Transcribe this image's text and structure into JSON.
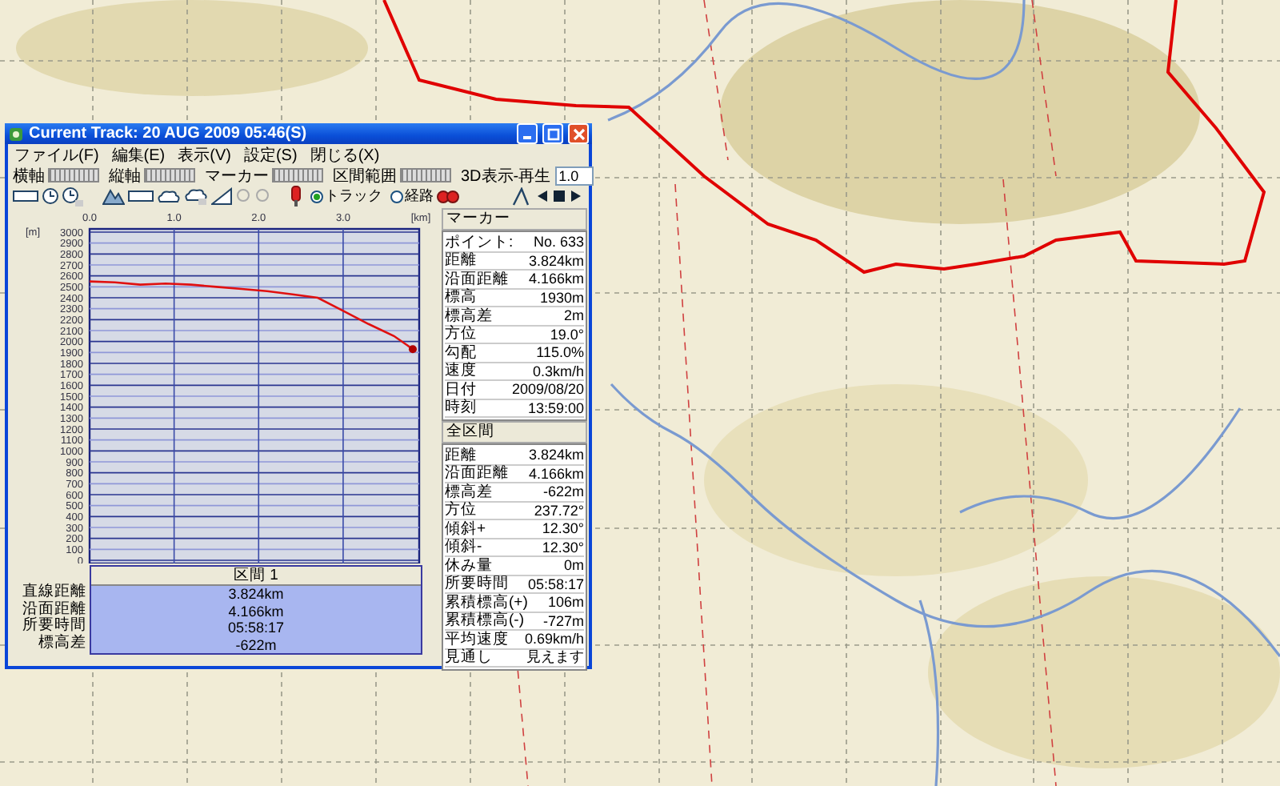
{
  "window": {
    "title": "Current Track: 20 AUG 2009 05:46(S)"
  },
  "menu": [
    "ファイル(F)",
    "編集(E)",
    "表示(V)",
    "設定(S)",
    "閉じる(X)"
  ],
  "toolbar": {
    "sliders": [
      {
        "label": "横軸"
      },
      {
        "label": "縦軸"
      },
      {
        "label": "マーカー"
      },
      {
        "label": "区間範囲"
      }
    ],
    "playback": {
      "label": "3D表示-再生",
      "value": "1.0"
    },
    "radios": [
      {
        "label": "トラック",
        "selected": true
      },
      {
        "label": "経路",
        "selected": false
      }
    ]
  },
  "profile": {
    "chart_data": {
      "type": "line",
      "xlabel": "[km]",
      "ylabel": "[m]",
      "xlim": [
        0,
        3.9
      ],
      "ylim": [
        0,
        3000
      ],
      "xticks": [
        {
          "value": 0,
          "label": "0.0"
        },
        {
          "value": 1,
          "label": "1.0"
        },
        {
          "value": 2,
          "label": "2.0"
        },
        {
          "value": 3,
          "label": "3.0"
        }
      ],
      "yticks": [
        0,
        100,
        200,
        300,
        400,
        500,
        600,
        700,
        800,
        900,
        1000,
        1100,
        1200,
        1300,
        1400,
        1500,
        1600,
        1700,
        1800,
        1900,
        2000,
        2100,
        2200,
        2300,
        2400,
        2500,
        2600,
        2700,
        2800,
        2900,
        3000
      ],
      "x": [
        0,
        0.3,
        0.6,
        0.9,
        1.2,
        1.5,
        1.8,
        2.1,
        2.4,
        2.7,
        3.0,
        3.3,
        3.6,
        3.824
      ],
      "values": [
        2550,
        2540,
        2520,
        2530,
        2520,
        2500,
        2480,
        2460,
        2430,
        2400,
        2280,
        2160,
        2050,
        1930
      ],
      "grid": true
    }
  },
  "section_table": {
    "header": "区間 1",
    "rows": [
      {
        "label": "直線距離",
        "value": "3.824km"
      },
      {
        "label": "沿面距離",
        "value": "4.166km"
      },
      {
        "label": "所要時間",
        "value": "05:58:17"
      },
      {
        "label": "標高差",
        "value": "-622m"
      }
    ]
  },
  "marker_panel": {
    "title": "マーカー",
    "rows": [
      {
        "label": "ポイント:",
        "value": "No. 633"
      },
      {
        "label": "距離",
        "value": "3.824km"
      },
      {
        "label": "沿面距離",
        "value": "4.166km"
      },
      {
        "label": "標高",
        "value": "1930m"
      },
      {
        "label": "標高差",
        "value": "2m"
      },
      {
        "label": "方位",
        "value": "19.0°"
      },
      {
        "label": "勾配",
        "value": "115.0%"
      },
      {
        "label": "速度",
        "value": "0.3km/h"
      },
      {
        "label": "日付",
        "value": "2009/08/20"
      },
      {
        "label": "時刻",
        "value": "13:59:00"
      }
    ]
  },
  "total_panel": {
    "title": "全区間",
    "rows": [
      {
        "label": "距離",
        "value": "3.824km"
      },
      {
        "label": "沿面距離",
        "value": "4.166km"
      },
      {
        "label": "標高差",
        "value": "-622m"
      },
      {
        "label": "方位",
        "value": "237.72°"
      },
      {
        "label": "傾斜+",
        "value": "12.30°"
      },
      {
        "label": "傾斜-",
        "value": "12.30°"
      },
      {
        "label": "休み量",
        "value": "0m"
      },
      {
        "label": "所要時間",
        "value": "05:58:17"
      },
      {
        "label": "累積標高(+)",
        "value": "106m"
      },
      {
        "label": "累積標高(-)",
        "value": "-727m"
      },
      {
        "label": "平均速度",
        "value": "0.69km/h"
      },
      {
        "label": "見通し",
        "value": "見えます"
      }
    ]
  }
}
